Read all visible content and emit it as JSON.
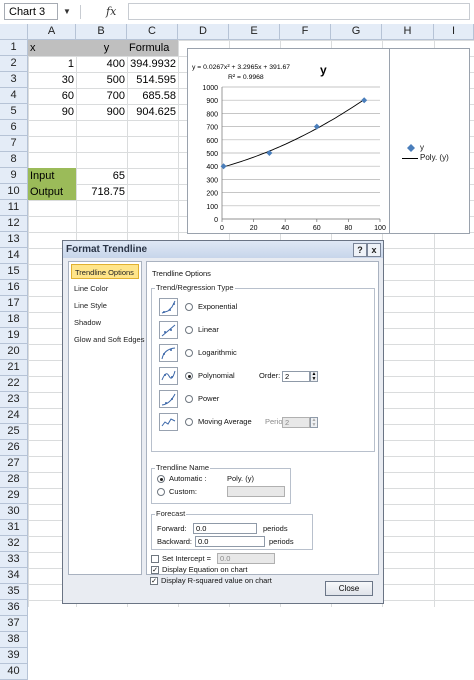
{
  "formula_bar": {
    "name_box": "Chart 3",
    "fx_label": "fx",
    "formula": ""
  },
  "columns": [
    "A",
    "B",
    "C",
    "D",
    "E",
    "F",
    "G",
    "H",
    "I"
  ],
  "rows": [
    "1",
    "2",
    "3",
    "4",
    "5",
    "6",
    "7",
    "8",
    "9",
    "10",
    "11",
    "12",
    "13",
    "14",
    "15",
    "16",
    "17",
    "18",
    "19",
    "20",
    "21",
    "22",
    "23",
    "24",
    "25",
    "26",
    "27",
    "28",
    "29",
    "30",
    "31",
    "32",
    "33",
    "34",
    "35",
    "36",
    "37",
    "38",
    "39",
    "40"
  ],
  "cells": {
    "A1": "x",
    "B1": "y",
    "C1": "Formula",
    "A2": "1",
    "B2": "400",
    "C2": "394.9932",
    "A3": "30",
    "B3": "500",
    "C3": "514.595",
    "A4": "60",
    "B4": "700",
    "C4": "685.58",
    "A5": "90",
    "B5": "900",
    "C5": "904.625",
    "A9": "Input",
    "B9": "65",
    "A10": "Output",
    "B10": "718.75"
  },
  "chart": {
    "equation": "y = 0.0267x² + 3.2965x + 391.67",
    "r_squared": "R² = 0.9968",
    "title": "y",
    "legend": {
      "series_label": "y",
      "trend_label": "Poly. (y)"
    }
  },
  "chart_data": {
    "type": "scatter",
    "title": "y",
    "x": [
      1,
      30,
      60,
      90
    ],
    "series": [
      {
        "name": "y",
        "values": [
          400,
          500,
          700,
          900
        ]
      }
    ],
    "trendline": {
      "name": "Poly. (y)",
      "type": "polynomial",
      "order": 2,
      "coefficients": [
        0.0267,
        3.2965,
        391.67
      ]
    },
    "xlim": [
      0,
      100
    ],
    "ylim": [
      0,
      1000
    ],
    "x_ticks": [
      "0",
      "20",
      "40",
      "60",
      "80",
      "100"
    ],
    "y_ticks": [
      "0",
      "100",
      "200",
      "300",
      "400",
      "500",
      "600",
      "700",
      "800",
      "900",
      "1000"
    ],
    "grid": "horizontal",
    "legend_position": "right",
    "colors": {
      "marker": "#4a7ebb",
      "trend": "#000000"
    }
  },
  "dialog": {
    "title": "Format Trendline",
    "help_btn": "?",
    "close_btn": "x",
    "nav": [
      "Trendline Options",
      "Line Color",
      "Line Style",
      "Shadow",
      "Glow and Soft Edges"
    ],
    "heading": "Trendline Options",
    "type_group": "Trend/Regression Type",
    "types": [
      "Exponential",
      "Linear",
      "Logarithmic",
      "Polynomial",
      "Power",
      "Moving Average"
    ],
    "order_label": "Order:",
    "order_value": "2",
    "period_label": "Period:",
    "period_value": "2",
    "name_group": "Trendline Name",
    "automatic_label": "Automatic :",
    "automatic_value": "Poly. (y)",
    "custom_label": "Custom:",
    "forecast_group": "Forecast",
    "forward_label": "Forward:",
    "forward_value": "0.0",
    "backward_label": "Backward:",
    "backward_value": "0.0",
    "periods_label": "periods",
    "intercept_label": "Set Intercept =",
    "intercept_value": "0.0",
    "display_equation": "Display Equation on chart",
    "display_r2": "Display R-squared value on chart",
    "close_label": "Close"
  }
}
